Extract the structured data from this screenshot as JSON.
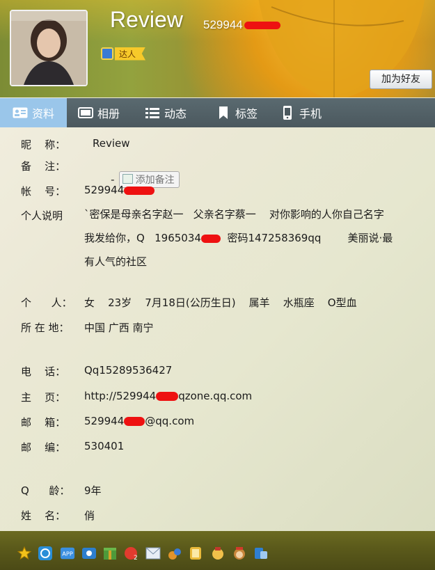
{
  "header": {
    "name": "Review",
    "qq_number": "529944",
    "badge": "达人",
    "add_friend": "加为好友"
  },
  "tabs": [
    {
      "label": "资料",
      "icon": "profile-card-icon"
    },
    {
      "label": "相册",
      "icon": "album-icon"
    },
    {
      "label": "动态",
      "icon": "feed-list-icon"
    },
    {
      "label": "标签",
      "icon": "bookmark-icon"
    },
    {
      "label": "手机",
      "icon": "phone-icon"
    }
  ],
  "profile": {
    "nickname_label": "昵    称：",
    "nickname": "Review",
    "remark_label": "备    注：",
    "remark": "-",
    "add_remark": "添加备注",
    "account_label": "帐    号：",
    "account": "529944",
    "bio_label": "个人说明",
    "bio_line1": "`密保是母亲名字赵一   父亲名字蔡一    对你影响的人你自己名字",
    "bio_line2_a": "我发给你，Q   1965034",
    "bio_line2_b": "  密码147258369qq        美丽说·最",
    "bio_line3": "有人气的社区",
    "personal_label": "个      人：",
    "personal": "女    23岁    7月18日(公历生日)    属羊    水瓶座    O型血",
    "location_label": "所 在 地：",
    "location": "中国 广西 南宁",
    "phone_label": "电    话：",
    "phone": "Qq15289536427",
    "homepage_label": "主    页：",
    "homepage_a": "http://529944",
    "homepage_b": "qzone.qq.com",
    "email_label": "邮    箱：",
    "email_a": "529944",
    "email_b": "@qq.com",
    "zip_label": "邮    编：",
    "zip": "530401",
    "qage_label": "Q      龄：",
    "qage": "9年",
    "realname_label": "姓    名：",
    "realname": "俏"
  },
  "toolbar_icons": [
    "star-icon",
    "qzone-icon",
    "app-icon",
    "mail-box-icon",
    "gift-icon",
    "qq-game-icon",
    "envelope-icon",
    "music-icon",
    "pay-icon",
    "pet-icon",
    "monkey-icon",
    "weibo-icon"
  ],
  "colors": {
    "active_tab": "#9ac6ea",
    "redaction": "#ee1111",
    "badge": "#f7c92a"
  }
}
